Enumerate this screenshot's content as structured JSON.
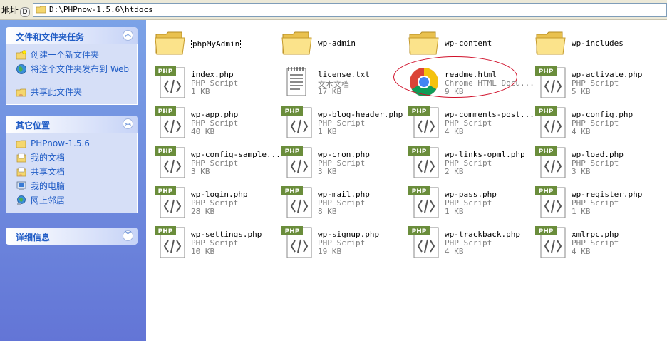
{
  "address_bar": {
    "label": "地址",
    "hotkey": "D",
    "path": "D:\\PHPnow-1.5.6\\htdocs"
  },
  "task_pane": {
    "file_tasks": {
      "title": "文件和文件夹任务",
      "items": [
        {
          "label": "创建一个新文件夹",
          "icon": "new-folder-icon"
        },
        {
          "label": "将这个文件夹发布到 Web",
          "icon": "publish-web-icon"
        },
        {
          "label": "共享此文件夹",
          "icon": "share-folder-icon"
        }
      ]
    },
    "other_places": {
      "title": "其它位置",
      "items": [
        {
          "label": "PHPnow-1.5.6",
          "icon": "folder-icon"
        },
        {
          "label": "我的文档",
          "icon": "my-documents-icon"
        },
        {
          "label": "共享文档",
          "icon": "shared-documents-icon"
        },
        {
          "label": "我的电脑",
          "icon": "my-computer-icon"
        },
        {
          "label": "网上邻居",
          "icon": "network-places-icon"
        }
      ]
    },
    "details": {
      "title": "详细信息"
    }
  },
  "files": [
    {
      "name": "phpMyAdmin",
      "kind": "folder"
    },
    {
      "name": "wp-admin",
      "kind": "folder"
    },
    {
      "name": "wp-content",
      "kind": "folder"
    },
    {
      "name": "wp-includes",
      "kind": "folder"
    },
    {
      "name": "index.php",
      "type": "PHP Script",
      "size": "1 KB",
      "kind": "php"
    },
    {
      "name": "license.txt",
      "type": "文本文档",
      "size": "17 KB",
      "kind": "txt"
    },
    {
      "name": "readme.html",
      "type": "Chrome HTML Docu...",
      "size": "9 KB",
      "kind": "chrome"
    },
    {
      "name": "wp-activate.php",
      "type": "PHP Script",
      "size": "5 KB",
      "kind": "php"
    },
    {
      "name": "wp-app.php",
      "type": "PHP Script",
      "size": "40 KB",
      "kind": "php"
    },
    {
      "name": "wp-blog-header.php",
      "type": "PHP Script",
      "size": "1 KB",
      "kind": "php"
    },
    {
      "name": "wp-comments-post...",
      "type": "PHP Script",
      "size": "4 KB",
      "kind": "php"
    },
    {
      "name": "wp-config.php",
      "type": "PHP Script",
      "size": "4 KB",
      "kind": "php"
    },
    {
      "name": "wp-config-sample...",
      "type": "PHP Script",
      "size": "3 KB",
      "kind": "php"
    },
    {
      "name": "wp-cron.php",
      "type": "PHP Script",
      "size": "3 KB",
      "kind": "php"
    },
    {
      "name": "wp-links-opml.php",
      "type": "PHP Script",
      "size": "2 KB",
      "kind": "php"
    },
    {
      "name": "wp-load.php",
      "type": "PHP Script",
      "size": "3 KB",
      "kind": "php"
    },
    {
      "name": "wp-login.php",
      "type": "PHP Script",
      "size": "28 KB",
      "kind": "php"
    },
    {
      "name": "wp-mail.php",
      "type": "PHP Script",
      "size": "8 KB",
      "kind": "php"
    },
    {
      "name": "wp-pass.php",
      "type": "PHP Script",
      "size": "1 KB",
      "kind": "php"
    },
    {
      "name": "wp-register.php",
      "type": "PHP Script",
      "size": "1 KB",
      "kind": "php"
    },
    {
      "name": "wp-settings.php",
      "type": "PHP Script",
      "size": "10 KB",
      "kind": "php"
    },
    {
      "name": "wp-signup.php",
      "type": "PHP Script",
      "size": "19 KB",
      "kind": "php"
    },
    {
      "name": "wp-trackback.php",
      "type": "PHP Script",
      "size": "4 KB",
      "kind": "php"
    },
    {
      "name": "xmlrpc.php",
      "type": "PHP Script",
      "size": "4 KB",
      "kind": "php"
    }
  ],
  "php_badge": "PHP",
  "colors": {
    "task_pane_top": "#7ba2e7",
    "task_pane_bottom": "#6375d6",
    "panel_title": "#215dc6",
    "annotation": "#d0102a"
  }
}
